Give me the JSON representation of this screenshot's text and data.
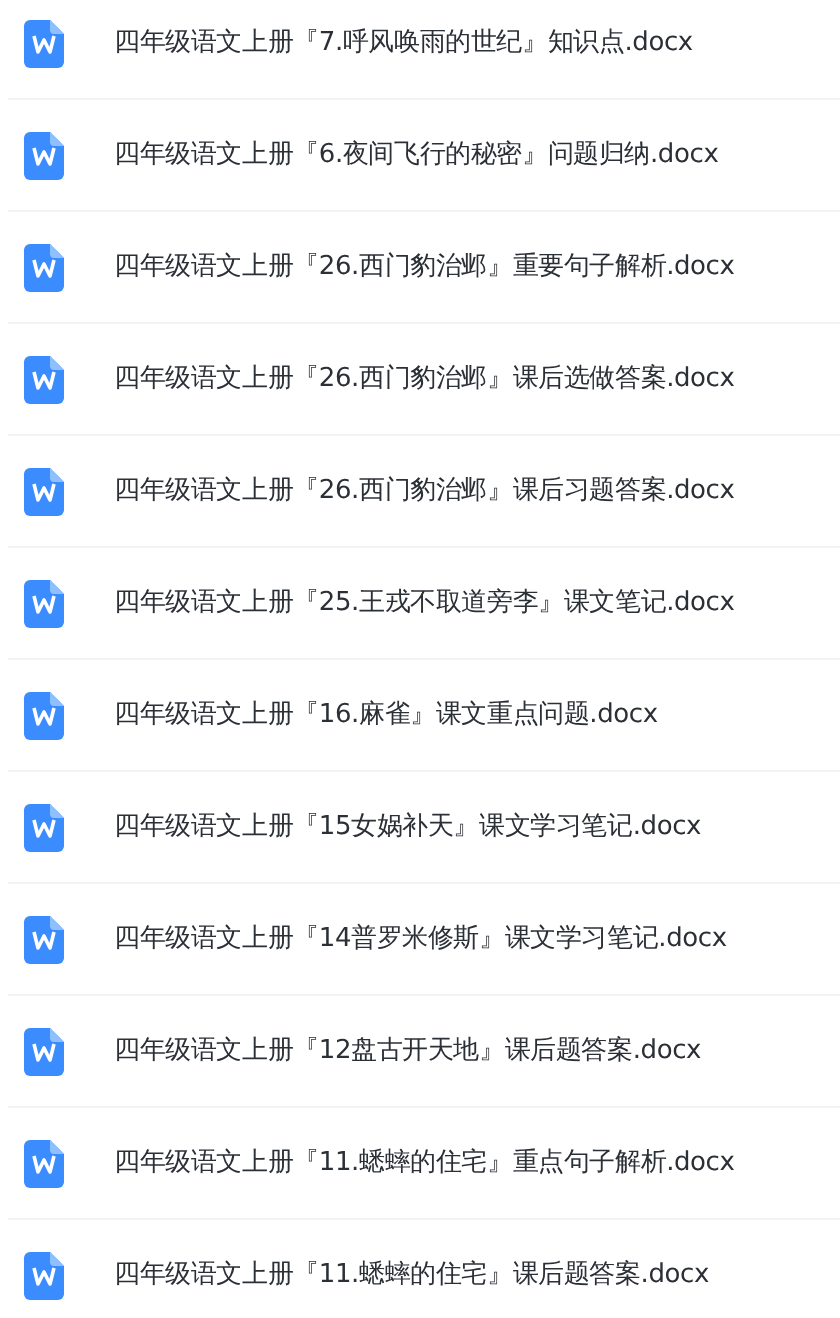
{
  "files": [
    {
      "name": "四年级语文上册『7.呼风唤雨的世纪』知识点.docx"
    },
    {
      "name": "四年级语文上册『6.夜间飞行的秘密』问题归纳.docx"
    },
    {
      "name": "四年级语文上册『26.西门豹治邺』重要句子解析.docx"
    },
    {
      "name": "四年级语文上册『26.西门豹治邺』课后选做答案.docx"
    },
    {
      "name": "四年级语文上册『26.西门豹治邺』课后习题答案.docx"
    },
    {
      "name": "四年级语文上册『25.王戎不取道旁李』课文笔记.docx"
    },
    {
      "name": "四年级语文上册『16.麻雀』课文重点问题.docx"
    },
    {
      "name": "四年级语文上册『15女娲补天』课文学习笔记.docx"
    },
    {
      "name": "四年级语文上册『14普罗米修斯』课文学习笔记.docx"
    },
    {
      "name": "四年级语文上册『12盘古开天地』课后题答案.docx"
    },
    {
      "name": "四年级语文上册『11.蟋蟀的住宅』重点句子解析.docx"
    },
    {
      "name": "四年级语文上册『11.蟋蟀的住宅』课后题答案.docx"
    }
  ]
}
